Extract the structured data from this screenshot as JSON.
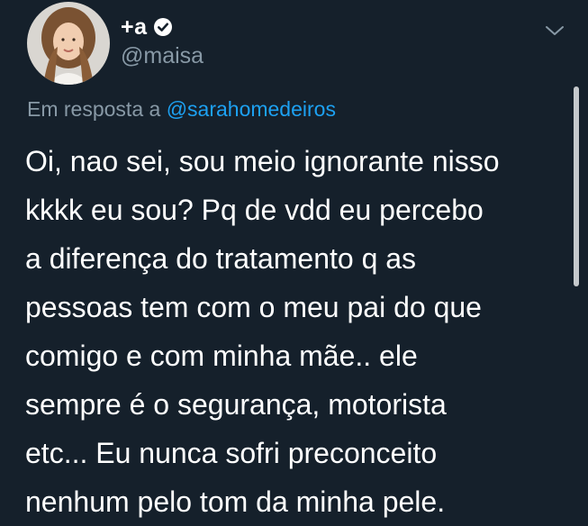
{
  "tweet": {
    "display_name": "+a",
    "handle": "@maisa",
    "reply_prefix": "Em resposta a",
    "reply_mention": "@sarahomedeiros",
    "body_lines": [
      "Oi, nao sei, sou meio ignorante nisso",
      "kkkk eu sou? Pq de vdd eu percebo",
      "a diferença do tratamento q as",
      "pessoas tem com o meu pai do que",
      "comigo e com minha mãe.. ele",
      "sempre é o segurança, motorista",
      "etc... Eu nunca sofri preconceito",
      "nenhum pelo tom da minha pele."
    ]
  },
  "icons": {
    "verified": "verified-badge-icon",
    "menu": "chevron-down-icon"
  },
  "colors": {
    "background": "#15202b",
    "primary_text": "#ffffff",
    "secondary_text": "#8899a6",
    "accent": "#1da1f2"
  }
}
